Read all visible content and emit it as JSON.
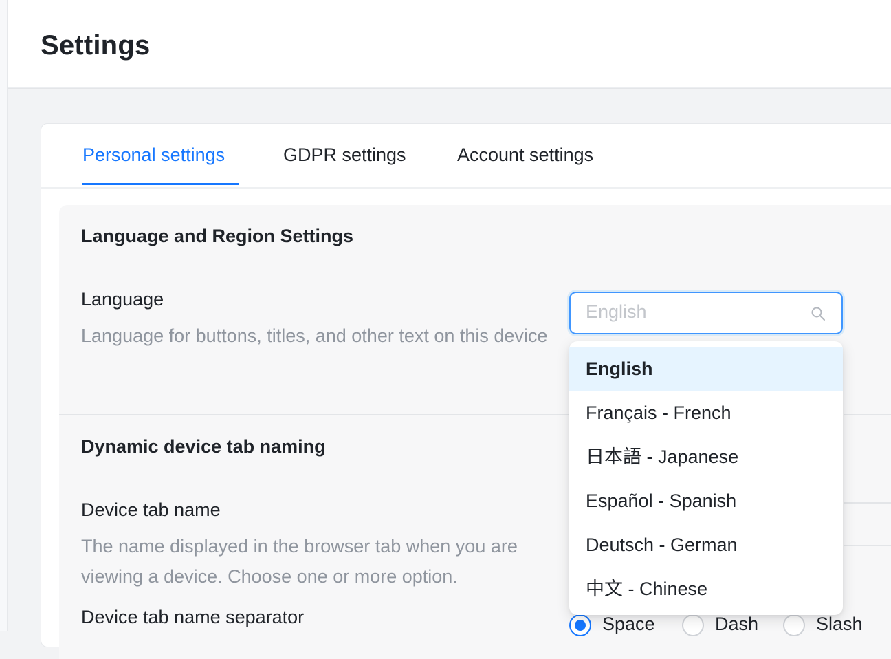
{
  "header": {
    "title": "Settings"
  },
  "tabs": [
    {
      "label": "Personal settings",
      "active": true
    },
    {
      "label": "GDPR settings",
      "active": false
    },
    {
      "label": "Account settings",
      "active": false
    }
  ],
  "language_section": {
    "title": "Language and Region Settings",
    "language_label": "Language",
    "language_description": "Language for buttons, titles, and other text on this device",
    "language_select": {
      "placeholder": "English",
      "value": "",
      "icon": "search-icon"
    },
    "dropdown_options": [
      {
        "label": "English",
        "selected": true
      },
      {
        "label": "Français - French",
        "selected": false
      },
      {
        "label": "日本語 - Japanese",
        "selected": false
      },
      {
        "label": "Español - Spanish",
        "selected": false
      },
      {
        "label": "Deutsch - German",
        "selected": false
      },
      {
        "label": "中文 - Chinese",
        "selected": false
      }
    ]
  },
  "device_tab_section": {
    "title": "Dynamic device tab naming",
    "tab_name_label": "Device tab name",
    "tab_name_description": "The name displayed in the browser tab when you are viewing a device. Choose one or more option.",
    "separator_label": "Device tab name separator",
    "separator_options": [
      {
        "label": "Space",
        "checked": true
      },
      {
        "label": "Dash",
        "checked": false
      },
      {
        "label": "Slash",
        "checked": false
      }
    ]
  },
  "colors": {
    "accent": "#1677ff",
    "selected_option_bg": "#e6f4ff",
    "muted_text": "#8f959e"
  }
}
